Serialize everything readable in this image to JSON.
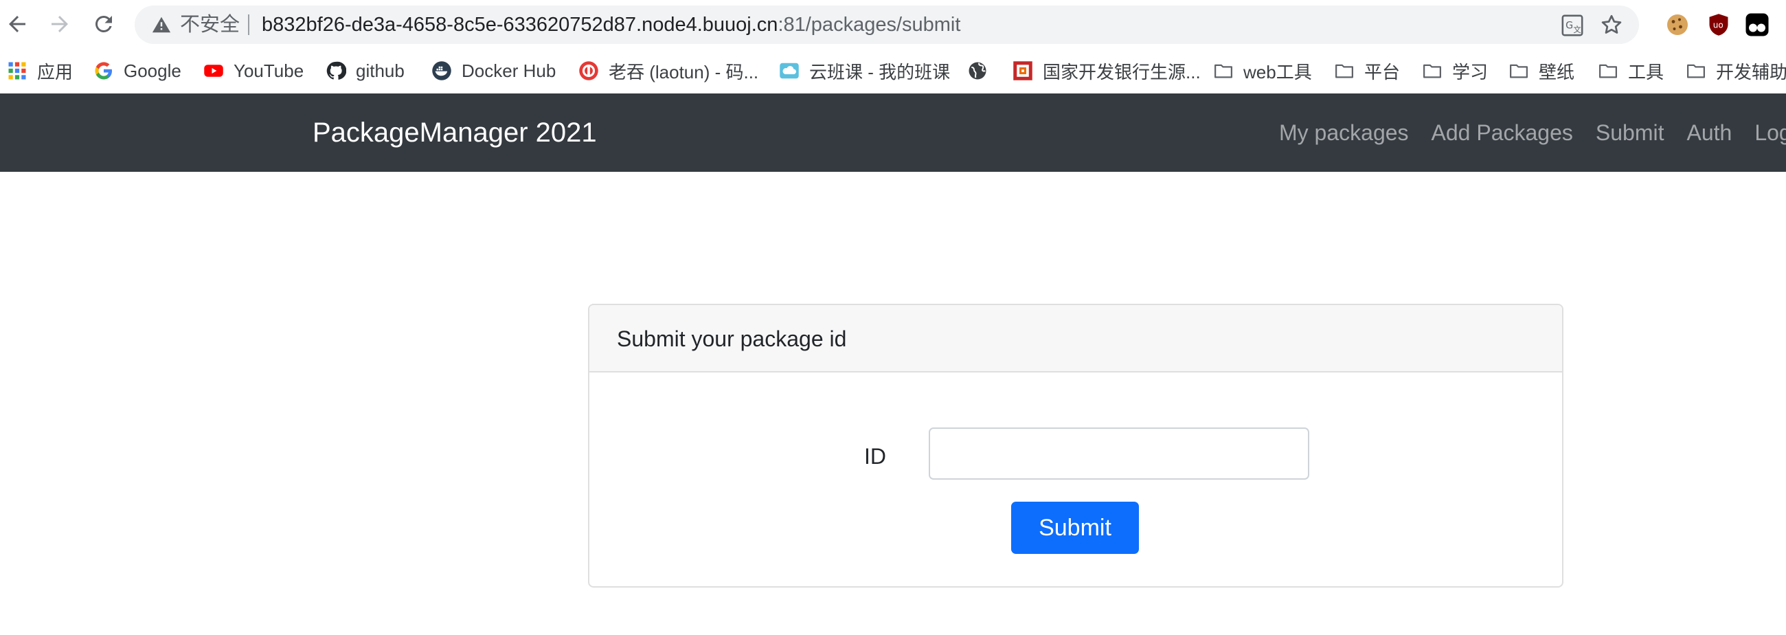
{
  "browser": {
    "security_label": "不安全",
    "url_host": "b832bf26-de3a-4658-8c5e-633620752d87.node4.buuoj.cn",
    "url_path": ":81/packages/submit"
  },
  "bookmarks": [
    {
      "label": "应用",
      "icon": "apps-grid-icon"
    },
    {
      "label": "Google",
      "icon": "google-icon"
    },
    {
      "label": "YouTube",
      "icon": "youtube-icon"
    },
    {
      "label": "github",
      "icon": "github-icon"
    },
    {
      "label": "Docker Hub",
      "icon": "docker-icon"
    },
    {
      "label": "老吞 (laotun) - 码...",
      "icon": "laotun-icon"
    },
    {
      "label": "云班课 - 我的班课",
      "icon": "cloud-class-icon"
    },
    {
      "label": "",
      "icon": "globe-icon"
    },
    {
      "label": "国家开发银行生源...",
      "icon": "bank-icon"
    },
    {
      "label": "web工具",
      "icon": "folder-icon"
    },
    {
      "label": "平台",
      "icon": "folder-icon"
    },
    {
      "label": "学习",
      "icon": "folder-icon"
    },
    {
      "label": "壁纸",
      "icon": "folder-icon"
    },
    {
      "label": "工具",
      "icon": "folder-icon"
    },
    {
      "label": "开发辅助",
      "icon": "folder-icon"
    }
  ],
  "navbar": {
    "brand": "PackageManager 2021",
    "links": [
      "My packages",
      "Add Packages",
      "Submit",
      "Auth",
      "Logout"
    ]
  },
  "card": {
    "title": "Submit your package id",
    "id_label": "ID",
    "id_value": "",
    "submit_label": "Submit"
  },
  "colors": {
    "navbar_bg": "#343a40",
    "primary": "#0d6efd",
    "card_header_bg": "#f7f7f7"
  }
}
